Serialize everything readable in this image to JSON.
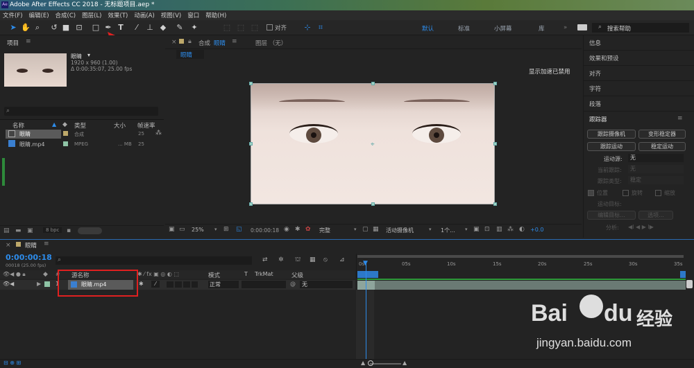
{
  "titlebar": {
    "logo": "Ae",
    "title": "Adobe After Effects CC 2018 - 无标题项目.aep *"
  },
  "menu": [
    "文件(F)",
    "编辑(E)",
    "合成(C)",
    "图层(L)",
    "效果(T)",
    "动画(A)",
    "视图(V)",
    "窗口",
    "帮助(H)"
  ],
  "toolbar": {
    "snap_label": "对齐",
    "workspaces": [
      "默认",
      "标准",
      "小屏幕",
      "库"
    ],
    "search_placeholder": "搜索帮助",
    "arrow_color": "#e02020"
  },
  "project": {
    "title": "项目",
    "item_name": "眼睛",
    "item_info1": "1920 x 960 (1.00)",
    "item_info2": "Δ 0:00:35:07, 25.00 fps",
    "columns": [
      "名称",
      "类型",
      "大小",
      "帧速率"
    ],
    "rows": [
      {
        "name": "眼睛",
        "type": "合成",
        "size": "",
        "fps": "25"
      },
      {
        "name": "眼睛.mp4",
        "type": "MPEG",
        "size": "... MB",
        "fps": "25"
      }
    ],
    "bpc": "8 bpc"
  },
  "composition": {
    "tab_prefix": "合成",
    "tab_name": "眼睛",
    "layer_tab": "图层 （无）",
    "sub_tab": "眼睛",
    "notice": "显示加速已禁用"
  },
  "viewer_bar": {
    "zoom": "25%",
    "timecode": "0:00:00:18",
    "quality": "完整",
    "camera": "活动摄像机",
    "views": "1个...",
    "exposure": "+0.0"
  },
  "right_panel": {
    "sections": [
      "信息",
      "效果和预设",
      "对齐",
      "字符",
      "段落"
    ],
    "tracker_title": "跟踪器",
    "buttons": [
      "跟踪摄像机",
      "变形稳定器",
      "跟踪运动",
      "稳定运动"
    ],
    "motion_source_label": "运动源:",
    "motion_source_value": "无",
    "current_track_label": "当前跟踪:",
    "current_track_value": "无",
    "track_type_label": "跟踪类型:",
    "track_type_value": "稳定",
    "checks": [
      "位置",
      "旋转",
      "缩放"
    ],
    "motion_target": "运动目标:",
    "edit_target": "编辑目标...",
    "options": "选项...",
    "analyze": "分析:"
  },
  "timeline": {
    "comp_name": "眼睛",
    "timecode": "0:00:00:18",
    "frame_info": "00018 (25.00 fps)",
    "search_placeholder": "",
    "col_source": "源名称",
    "col_mode": "模式",
    "col_t": "T",
    "col_trkmat": "TrkMat",
    "col_parent": "父级",
    "layer_num": "1",
    "layer_name": "眼睛.mp4",
    "layer_mode": "正常",
    "layer_parent": "无",
    "ticks": [
      "0s",
      "05s",
      "10s",
      "15s",
      "20s",
      "25s",
      "30s",
      "35s"
    ]
  },
  "watermark": {
    "brand": "Bai",
    "brand2": "du",
    "brand_cn": "经验",
    "url": "jingyan.baidu.com"
  }
}
